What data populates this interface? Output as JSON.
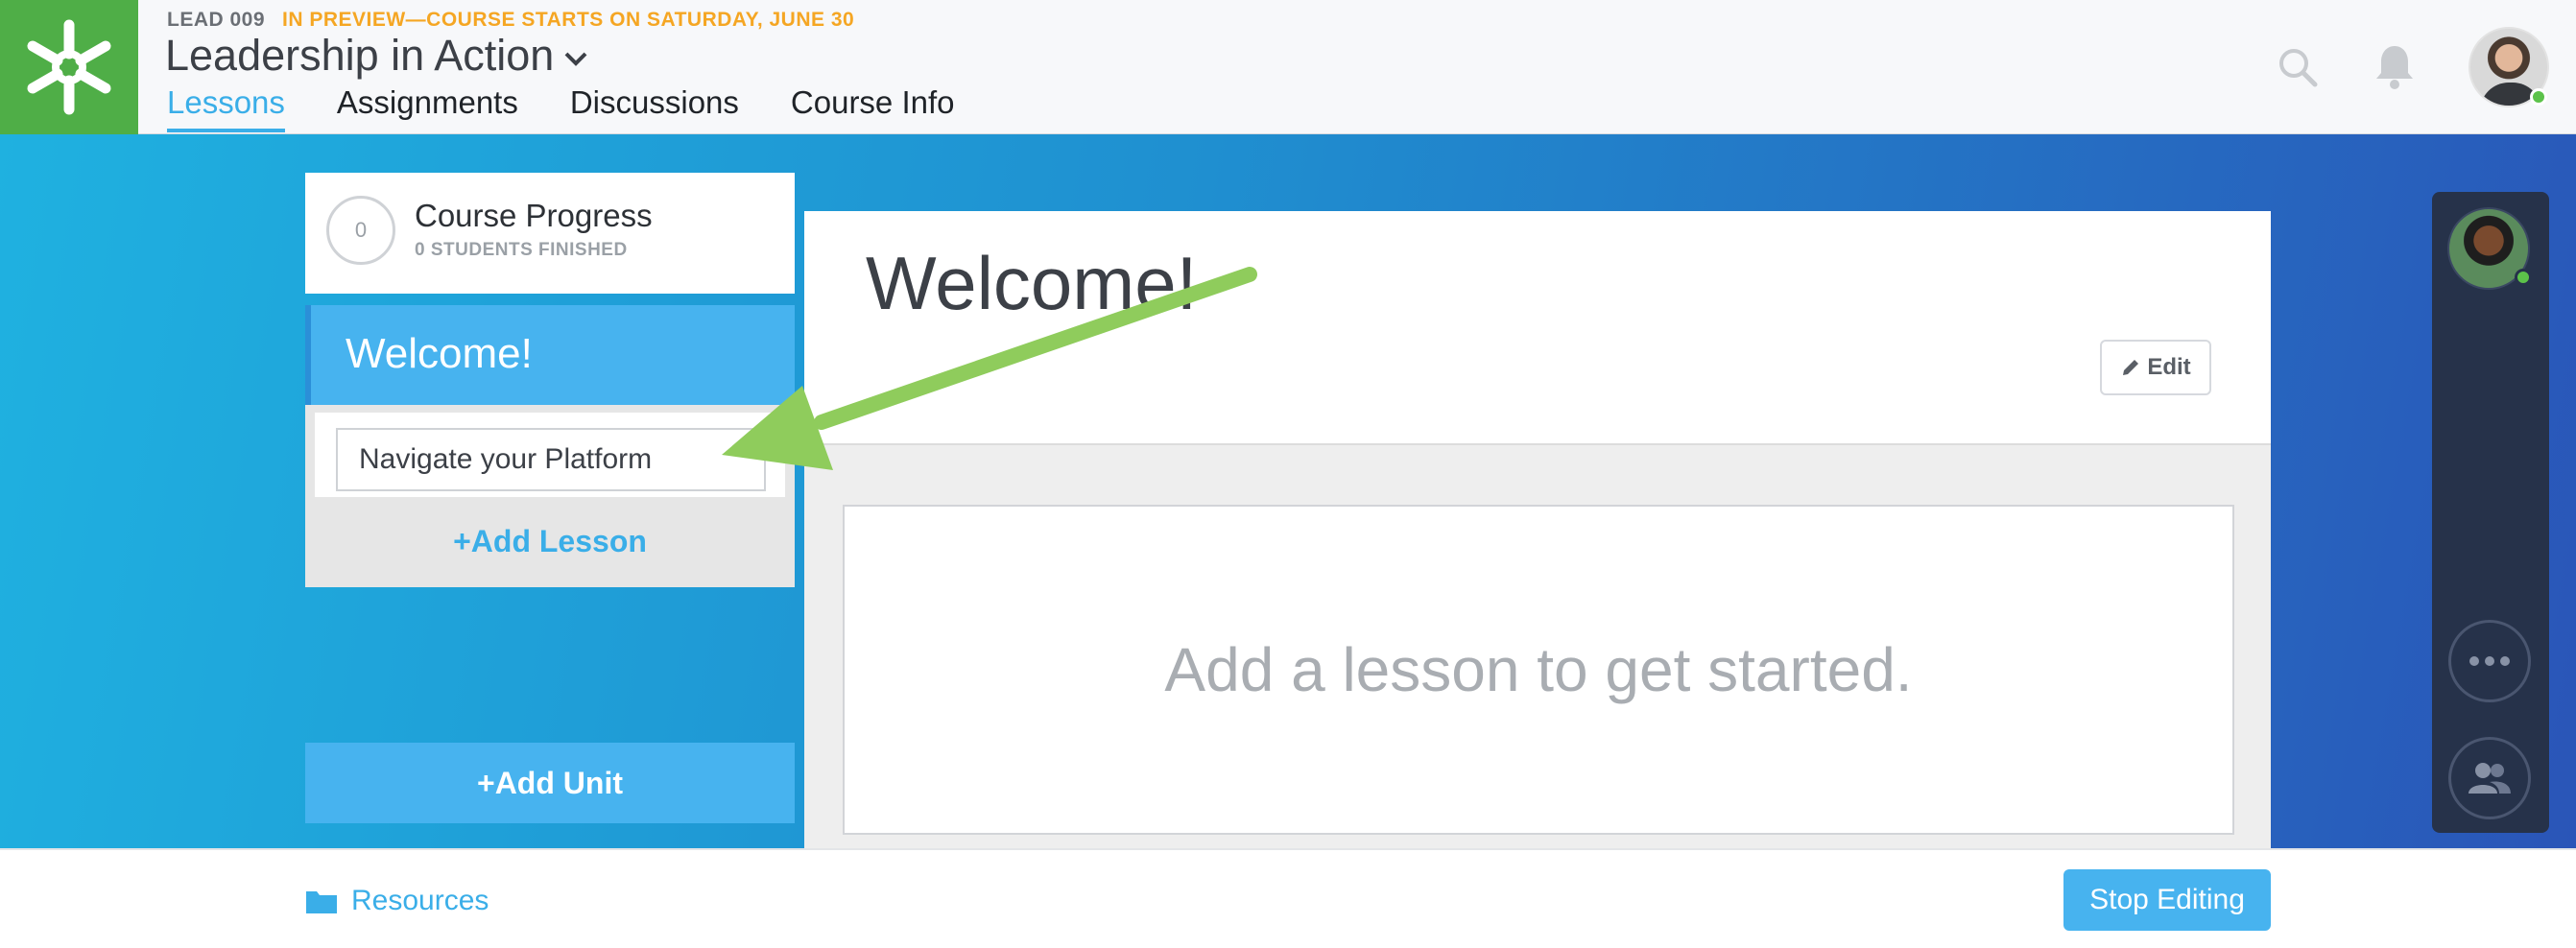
{
  "header": {
    "course_code": "LEAD 009",
    "preview_note": "IN PREVIEW—COURSE STARTS ON SATURDAY, JUNE 30",
    "course_title": "Leadership in Action",
    "tabs": [
      {
        "label": "Lessons",
        "active": true
      },
      {
        "label": "Assignments",
        "active": false
      },
      {
        "label": "Discussions",
        "active": false
      },
      {
        "label": "Course Info",
        "active": false
      }
    ],
    "icons": [
      "logo-icon",
      "chevron-down-icon",
      "search-icon",
      "bell-icon",
      "user-avatar"
    ]
  },
  "progress": {
    "count": "0",
    "title": "Course Progress",
    "subtitle": "0 STUDENTS FINISHED"
  },
  "unit": {
    "title": "Welcome!",
    "lesson_input_value": "Navigate your Platform",
    "add_lesson_label": "+Add Lesson",
    "add_unit_label": "+Add Unit"
  },
  "content": {
    "title": "Welcome!",
    "edit_label": "Edit",
    "placeholder": "Add a lesson to get started."
  },
  "footer": {
    "resources_label": "Resources",
    "stop_editing_label": "Stop Editing"
  },
  "colors": {
    "brand_green": "#4fae47",
    "accent_blue": "#3aaee8",
    "preview_orange": "#f5a623",
    "arrow_green": "#8fcc5c"
  }
}
